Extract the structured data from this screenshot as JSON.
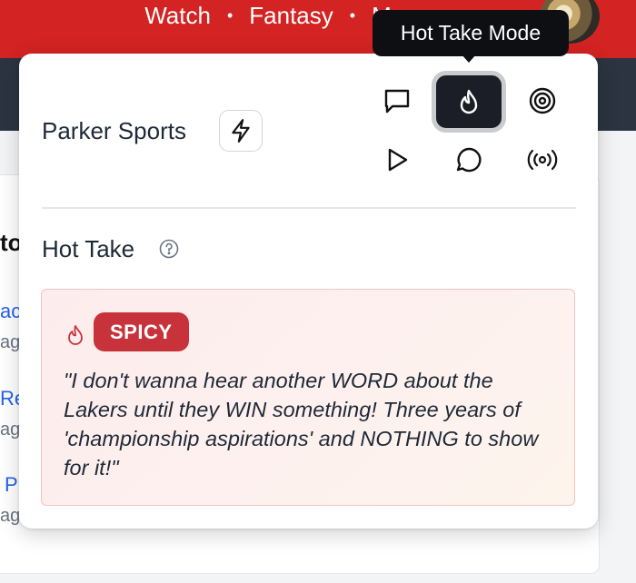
{
  "topnav": {
    "items": [
      "Watch",
      "Fantasy",
      "M"
    ],
    "separator": "•"
  },
  "background": {
    "heading_fragment": "to",
    "link_fragments": [
      "ac",
      "Re",
      "P"
    ],
    "meta_fragments": [
      "ag",
      "ag",
      "ag"
    ]
  },
  "popover": {
    "brand": "Parker Sports",
    "tooltip": "Hot Take Mode",
    "modes": [
      {
        "name": "chat-mode",
        "icon": "square-chat-icon"
      },
      {
        "name": "hot-take-mode",
        "icon": "flame-icon",
        "active": true
      },
      {
        "name": "target-mode",
        "icon": "target-icon"
      },
      {
        "name": "play-mode",
        "icon": "play-icon"
      },
      {
        "name": "comment-mode",
        "icon": "round-chat-icon"
      },
      {
        "name": "broadcast-mode",
        "icon": "broadcast-icon"
      }
    ],
    "section_title": "Hot Take",
    "take": {
      "level": "SPICY",
      "quote": "\"I don't wanna hear another WORD about the Lakers until they WIN something! Three years of 'championship aspirations' and NOTHING to show for it!\""
    }
  },
  "colors": {
    "brand_red": "#d32323",
    "badge_red": "#c8323b",
    "active_mode_bg": "#1b1e26",
    "link_blue": "#2563eb"
  }
}
